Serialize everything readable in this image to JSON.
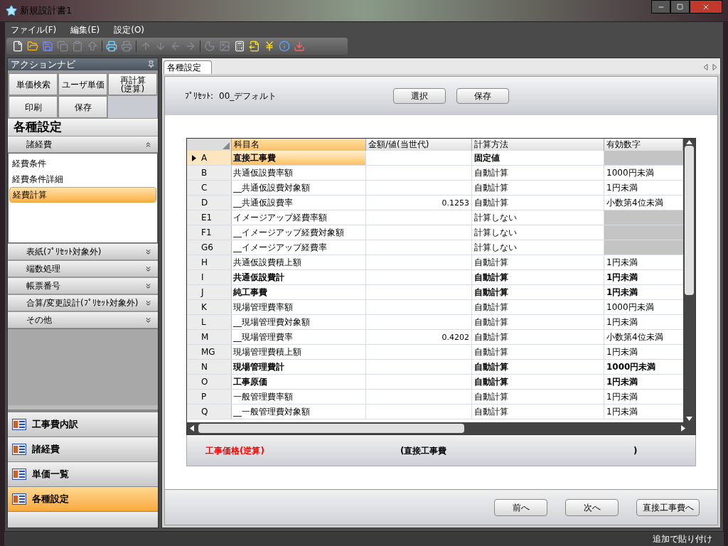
{
  "window": {
    "title": "新規設計書1"
  },
  "menu": [
    "ファイル(F)",
    "編集(E)",
    "設定(O)"
  ],
  "toolbar": [
    {
      "kind": "new",
      "disabled": false
    },
    {
      "kind": "open",
      "disabled": false
    },
    {
      "kind": "save",
      "disabled": false
    },
    {
      "kind": "copy",
      "disabled": true
    },
    {
      "kind": "paste",
      "disabled": true
    },
    {
      "kind": "upload",
      "disabled": true
    },
    {
      "kind": "sep"
    },
    {
      "kind": "print",
      "disabled": false
    },
    {
      "kind": "preview",
      "disabled": true
    },
    {
      "kind": "sep"
    },
    {
      "kind": "up",
      "disabled": true
    },
    {
      "kind": "down",
      "disabled": true
    },
    {
      "kind": "left",
      "disabled": true
    },
    {
      "kind": "right",
      "disabled": true
    },
    {
      "kind": "sep"
    },
    {
      "kind": "moon",
      "disabled": true
    },
    {
      "kind": "image",
      "disabled": true
    },
    {
      "kind": "calc",
      "disabled": false
    },
    {
      "kind": "export",
      "disabled": false
    },
    {
      "kind": "yen",
      "disabled": false
    },
    {
      "kind": "info",
      "disabled": false
    },
    {
      "kind": "import",
      "disabled": false
    }
  ],
  "action_nav": {
    "title": "アクションナビ",
    "buttons": [
      "単価検索",
      "ユーザ単価",
      "再計算\n(逆算)",
      "印刷",
      "保存"
    ],
    "heading": "各種設定",
    "sections": [
      {
        "label": "諸経費",
        "expanded": true,
        "items": [
          {
            "label": "経費条件",
            "selected": false
          },
          {
            "label": "経費条件詳細",
            "selected": false
          },
          {
            "label": "経費計算",
            "selected": true
          }
        ]
      },
      {
        "label": "表紙(ﾌﾟﾘｾｯﾄ対象外)",
        "expanded": false
      },
      {
        "label": "端数処理",
        "expanded": false
      },
      {
        "label": "帳票番号",
        "expanded": false
      },
      {
        "label": "合算/変更設計(ﾌﾟﾘｾｯﾄ対象外)",
        "expanded": false
      },
      {
        "label": "その他",
        "expanded": false
      }
    ]
  },
  "nav_items": [
    {
      "label": "工事費内訳",
      "selected": false
    },
    {
      "label": "諸経費",
      "selected": false
    },
    {
      "label": "単価一覧",
      "selected": false
    },
    {
      "label": "各種設定",
      "selected": true
    }
  ],
  "tab": {
    "label": "各種設定",
    "selected": true
  },
  "preset": {
    "label": "ﾌﾟﾘｾｯﾄ:",
    "value": "00_デフォルト",
    "buttons": [
      "選択",
      "保存"
    ]
  },
  "table": {
    "columns": [
      "科目名",
      "金額/値(当世代)",
      "計算方法",
      "有効数字"
    ],
    "rows": [
      {
        "code": "A",
        "name": "直接工事費",
        "value": "",
        "method": "固定値",
        "digits": "",
        "bold": true,
        "current": true
      },
      {
        "code": "B",
        "name": "共通仮設費率額",
        "value": "",
        "method": "自動計算",
        "digits": "1000円未満",
        "bold": false,
        "current": false
      },
      {
        "code": "C",
        "name": "__共通仮設費対象額",
        "value": "",
        "method": "自動計算",
        "digits": "1円未満",
        "bold": false,
        "current": false
      },
      {
        "code": "D",
        "name": "__共通仮設費率",
        "value": "0.1253",
        "method": "自動計算",
        "digits": "小数第4位未満",
        "bold": false,
        "current": false
      },
      {
        "code": "E1",
        "name": "イメージアップ経費率額",
        "value": "",
        "method": "計算しない",
        "digits": "",
        "bold": false,
        "current": false
      },
      {
        "code": "F1",
        "name": "__イメージアップ経費対象額",
        "value": "",
        "method": "計算しない",
        "digits": "",
        "bold": false,
        "current": false
      },
      {
        "code": "G6",
        "name": "__イメージアップ経費率",
        "value": "",
        "method": "計算しない",
        "digits": "",
        "bold": false,
        "current": false
      },
      {
        "code": "H",
        "name": "共通仮設費積上額",
        "value": "",
        "method": "自動計算",
        "digits": "1円未満",
        "bold": false,
        "current": false
      },
      {
        "code": "I",
        "name": "共通仮設費計",
        "value": "",
        "method": "自動計算",
        "digits": "1円未満",
        "bold": true,
        "current": false
      },
      {
        "code": "J",
        "name": "純工事費",
        "value": "",
        "method": "自動計算",
        "digits": "1円未満",
        "bold": true,
        "current": false
      },
      {
        "code": "K",
        "name": "現場管理費率額",
        "value": "",
        "method": "自動計算",
        "digits": "1000円未満",
        "bold": false,
        "current": false
      },
      {
        "code": "L",
        "name": "__現場管理費対象額",
        "value": "",
        "method": "自動計算",
        "digits": "1円未満",
        "bold": false,
        "current": false
      },
      {
        "code": "M",
        "name": "__現場管理費率",
        "value": "0.4202",
        "method": "自動計算",
        "digits": "小数第4位未満",
        "bold": false,
        "current": false
      },
      {
        "code": "MG",
        "name": "現場管理費積上額",
        "value": "",
        "method": "自動計算",
        "digits": "1円未満",
        "bold": false,
        "current": false
      },
      {
        "code": "N",
        "name": "現場管理費計",
        "value": "",
        "method": "自動計算",
        "digits": "1000円未満",
        "bold": true,
        "current": false
      },
      {
        "code": "O",
        "name": "工事原価",
        "value": "",
        "method": "自動計算",
        "digits": "1円未満",
        "bold": true,
        "current": false
      },
      {
        "code": "P",
        "name": "一般管理費率額",
        "value": "",
        "method": "自動計算",
        "digits": "1円未満",
        "bold": false,
        "current": false
      },
      {
        "code": "Q",
        "name": "__一般管理費対象額",
        "value": "",
        "method": "自動計算",
        "digits": "1円未満",
        "bold": false,
        "current": false
      }
    ]
  },
  "formula": {
    "label": "工事価格(逆算)",
    "expression": "(直接工事費",
    "closing": ")"
  },
  "footer_buttons": [
    "前へ",
    "次へ",
    "直接工事費へ"
  ],
  "status_bar": "追加で貼り付け"
}
